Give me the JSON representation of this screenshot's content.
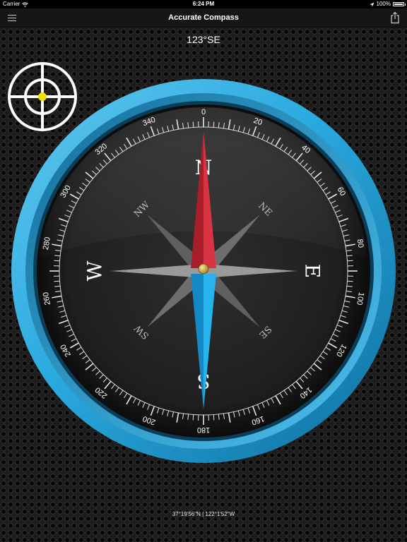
{
  "status": {
    "carrier": "Carrier",
    "time": "6:24 PM",
    "battery": "100%"
  },
  "nav": {
    "title": "Accurate Compass"
  },
  "heading": "123°SE",
  "coordinates": "37°19'56\"N | 122°1'52\"W",
  "compass": {
    "degree_labels": [
      "0",
      "20",
      "40",
      "60",
      "80",
      "100",
      "120",
      "140",
      "160",
      "180",
      "200",
      "220",
      "240",
      "260",
      "280",
      "300",
      "320",
      "340"
    ],
    "cardinals": {
      "n": "N",
      "e": "E",
      "s": "S",
      "w": "W"
    },
    "intercardinals": {
      "ne": "NE",
      "se": "SE",
      "sw": "SW",
      "nw": "NW"
    },
    "heading_degrees": 123
  },
  "colors": {
    "ring": "#2aa9de",
    "needle_north": "#c62a35",
    "needle_south": "#1ba0e2",
    "center_pin": "#c9a13a",
    "target_dot": "#f2e200"
  },
  "icons": {
    "menu": "hamburger-menu-icon",
    "share": "share-icon",
    "wifi": "wifi-icon",
    "location": "location-arrow-icon",
    "battery": "battery-icon",
    "target": "crosshair-icon"
  }
}
